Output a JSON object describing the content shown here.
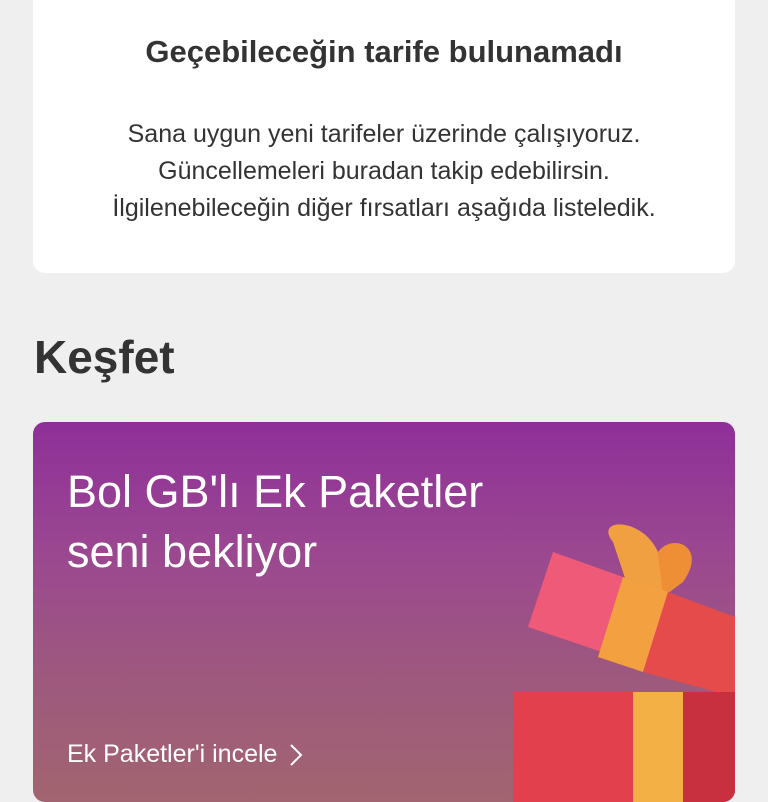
{
  "info_card": {
    "title": "Geçebileceğin tarife bulunamadı",
    "line1": "Sana uygun yeni tarifeler üzerinde çalışıyoruz.",
    "line2": "Güncellemeleri buradan takip edebilirsin.",
    "line3": "İlgilenebileceğin diğer fırsatları aşağıda listeledik."
  },
  "discover": {
    "section_title": "Keşfet",
    "promo": {
      "title_line1": "Bol GB'lı Ek Paketler",
      "title_line2": "seni bekliyor",
      "link_label": "Ek Paketler'i incele",
      "link_icon": "chevron-right-icon",
      "image": "gift-box-icon"
    }
  },
  "colors": {
    "background": "#efefef",
    "card": "#ffffff",
    "text": "#333333",
    "promo_gradient_top": "#8e2f99",
    "promo_gradient_bottom": "#a26470"
  }
}
